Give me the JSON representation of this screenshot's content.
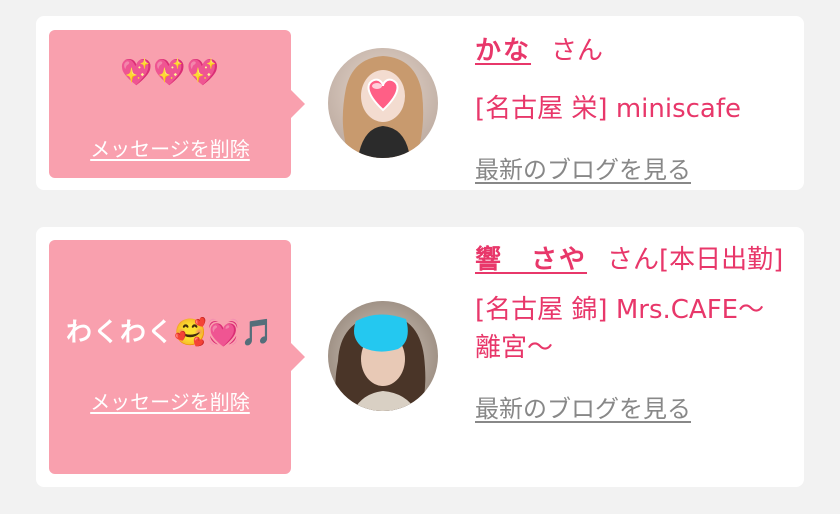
{
  "messages": [
    {
      "message": "💖💖💖",
      "delete_label": "メッセージを削除",
      "name": "かな",
      "honorific": "さん",
      "shop": "[名古屋 栄] miniscafe",
      "blog_link": "最新のブログを見る"
    },
    {
      "message": "わくわく🥰💓🎵",
      "delete_label": "メッセージを削除",
      "name": "響　さや",
      "honorific": "さん[本日出勤]",
      "shop": "[名古屋 錦] Mrs.CAFE〜離宮〜",
      "blog_link": "最新のブログを見る"
    }
  ],
  "colors": {
    "bubble": "#f9a0ae",
    "accent": "#e8376a",
    "link_gray": "#888888",
    "background": "#f2f2f2"
  }
}
